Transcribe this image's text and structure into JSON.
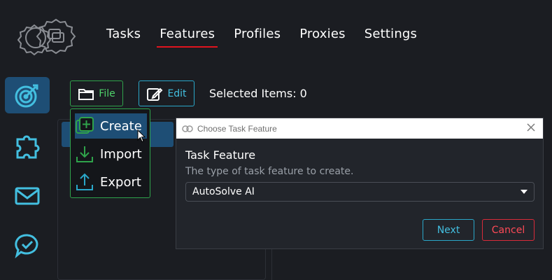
{
  "nav": {
    "items": [
      "Tasks",
      "Features",
      "Profiles",
      "Proxies",
      "Settings"
    ],
    "active": "Features"
  },
  "sidebar": {
    "icons": [
      "target-icon",
      "puzzle-icon",
      "mail-icon",
      "chat-check-icon"
    ],
    "active": "target-icon"
  },
  "toolbar": {
    "file_label": "File",
    "edit_label": "Edit",
    "selected_items": "Selected Items: 0"
  },
  "file_menu": {
    "items": [
      {
        "label": "Create",
        "icon": "create-icon"
      },
      {
        "label": "Import",
        "icon": "import-icon"
      },
      {
        "label": "Export",
        "icon": "export-icon"
      }
    ],
    "hovered": "Create"
  },
  "dialog": {
    "title": "Choose Task Feature",
    "field_label": "Task Feature",
    "field_help": "The type of task feature to create.",
    "selected_value": "AutoSolve AI",
    "next_label": "Next",
    "cancel_label": "Cancel"
  },
  "colors": {
    "background": "#1b1d22",
    "accent_blue": "#1e4e75",
    "green": "#2fa34b",
    "cyan": "#2aa7c9",
    "red": "#e0141e"
  }
}
